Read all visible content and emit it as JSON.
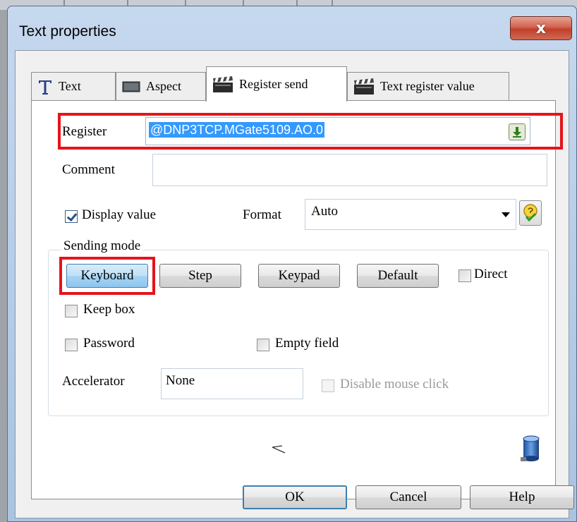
{
  "window": {
    "title": "Text properties",
    "close_glyph": "x"
  },
  "tabs": [
    {
      "label": "Text",
      "icon": "text-t-icon",
      "active": false
    },
    {
      "label": "Aspect",
      "icon": "aspect-icon",
      "active": false
    },
    {
      "label": "Register send",
      "icon": "clapperboard-icon",
      "active": true
    },
    {
      "label": "Text register value",
      "icon": "clapperboard-icon",
      "active": false
    }
  ],
  "register": {
    "label": "Register",
    "value": "@DNP3TCP.MGate5109.AO.0",
    "picker_icon": "download-arrow-icon"
  },
  "comment": {
    "label": "Comment",
    "value": ""
  },
  "display_value": {
    "label": "Display value",
    "checked": true
  },
  "format": {
    "label": "Format",
    "value": "Auto",
    "icon": "format-coin-icon"
  },
  "sending_mode": {
    "legend": "Sending mode",
    "buttons": [
      "Keyboard",
      "Step",
      "Keypad",
      "Default"
    ],
    "pressed": "Keyboard",
    "direct": {
      "label": "Direct",
      "checked": false
    },
    "keep_box": {
      "label": "Keep box",
      "checked": false
    },
    "password": {
      "label": "Password",
      "checked": false
    },
    "empty_field": {
      "label": "Empty field",
      "checked": false
    },
    "accelerator": {
      "label": "Accelerator",
      "value": "None"
    },
    "disable_mouse_click": {
      "label": "Disable mouse click",
      "checked": false,
      "enabled": false
    }
  },
  "footer": {
    "ok": "OK",
    "cancel": "Cancel",
    "help": "Help"
  },
  "colors": {
    "highlight": "#e5141b",
    "selection": "#3399ff",
    "frame": "#b4cbe6"
  }
}
